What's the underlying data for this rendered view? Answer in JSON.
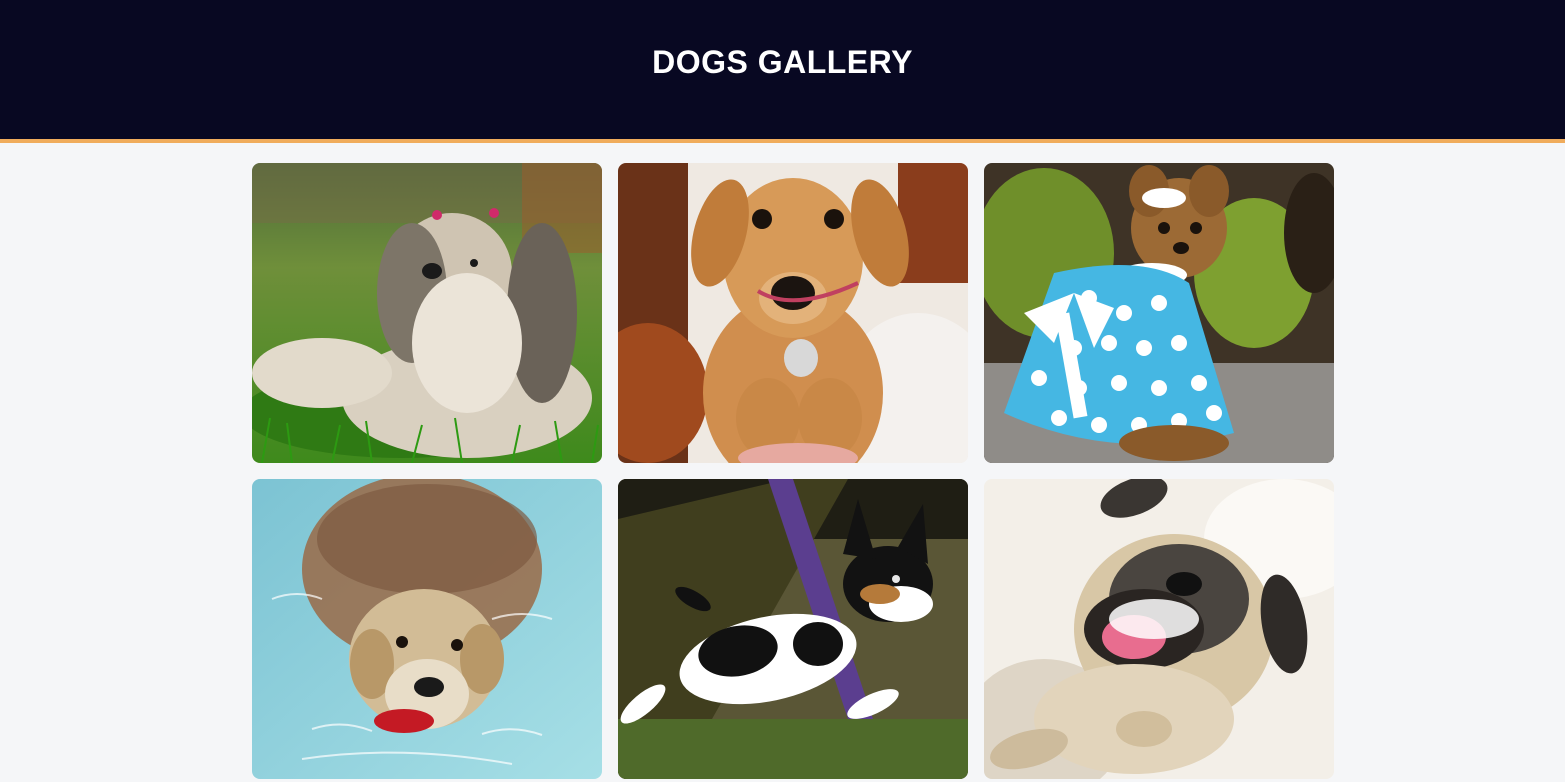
{
  "header": {
    "title": "DOGS GALLERY",
    "background": "#080822",
    "accent_border": "#f0ac5c"
  },
  "gallery": {
    "items": [
      {
        "subject": "shih-tzu-on-grass",
        "colors": [
          "#5a9a2a",
          "#e8e0d0"
        ]
      },
      {
        "subject": "labrador-puppy-with-tag",
        "colors": [
          "#d79a58",
          "#f2ede8"
        ]
      },
      {
        "subject": "yorkie-in-blue-polka-dot-dress",
        "colors": [
          "#45b7e3",
          "#6e8f2a"
        ]
      },
      {
        "subject": "golden-retriever-swimming",
        "colors": [
          "#8fd3dd",
          "#b07a4a"
        ]
      },
      {
        "subject": "terrier-jumping",
        "colors": [
          "#3a3a1e",
          "#ffffff"
        ]
      },
      {
        "subject": "smiling-pug",
        "colors": [
          "#f3efe8",
          "#d8c7a6"
        ]
      }
    ]
  }
}
